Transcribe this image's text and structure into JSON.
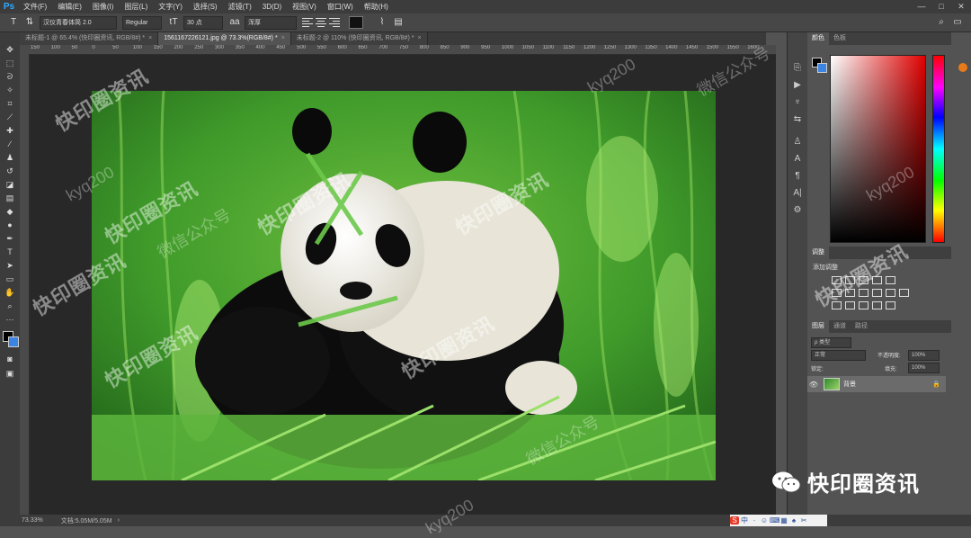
{
  "app": {
    "logo": "Ps"
  },
  "menu": [
    "文件(F)",
    "编辑(E)",
    "图像(I)",
    "图层(L)",
    "文字(Y)",
    "选择(S)",
    "滤镜(T)",
    "3D(D)",
    "视图(V)",
    "窗口(W)",
    "帮助(H)"
  ],
  "window_controls": {
    "minimize": "—",
    "maximize": "□",
    "close": "✕"
  },
  "options": {
    "tool_icon": "T",
    "font_family": "汉仪青春体简 2.0",
    "font_style": "Regular",
    "font_size": "30 点",
    "antialias": "浑厚",
    "orient_glyph": "⇅",
    "size_glyph": "tT",
    "aa_glyph": "aa",
    "warp_glyph": "⌇",
    "panels_glyph": "▤",
    "text_color": "#111111",
    "right_icons": {
      "search": "⌕",
      "workspace": "▭"
    }
  },
  "tabs": [
    {
      "label": "未标题-1 @ 65.4% (快印圈资讯, RGB/8#) *",
      "close": "×"
    },
    {
      "label": "15611672261​21.jpg @ 73.3%(RGB/8#) *",
      "close": "×"
    },
    {
      "label": "未标题-2 @ 110% (快印圈资讯, RGB/8#) *",
      "close": "×"
    }
  ],
  "ruler_ticks": [
    "150",
    "100",
    "50",
    "0",
    "50",
    "100",
    "150",
    "200",
    "250",
    "300",
    "350",
    "400",
    "450",
    "500",
    "550",
    "600",
    "650",
    "700",
    "750",
    "800",
    "850",
    "900",
    "950",
    "1000",
    "1050",
    "1100",
    "1150",
    "1200",
    "1250",
    "1300",
    "1350",
    "1400",
    "1450",
    "1500",
    "1550",
    "1600"
  ],
  "panels": {
    "color_tabs": [
      "颜色",
      "色板"
    ],
    "adjust_tabs": [
      "调整"
    ],
    "adjust_title": "添加调整",
    "layers_tabs": [
      "图层",
      "通道",
      "路径"
    ],
    "layer_kind": "ρ 类型",
    "blend_mode": "正常",
    "opacity_label": "不透明度:",
    "opacity_value": "100%",
    "lock_label": "锁定:",
    "fill_label": "填充:",
    "fill_value": "100%",
    "layer_name": "背景",
    "layer_lock": "🔒",
    "layer_eye": "👁"
  },
  "status": {
    "zoom": "73.33%",
    "doc": "文档:5.05M/5.05M",
    "arrow": "›"
  },
  "ime": [
    "S",
    "中",
    "·",
    "☺",
    "⌨",
    "▦",
    "♠",
    "✂"
  ],
  "watermark": {
    "text": "快印圈资讯",
    "account": "微信公众号",
    "id": "kyq200"
  },
  "brand": {
    "label": "快印圈资讯"
  },
  "colors": {
    "accent": "#31a8ff",
    "background_swatch": "#3b84e4",
    "foreground_swatch": "#000000"
  }
}
